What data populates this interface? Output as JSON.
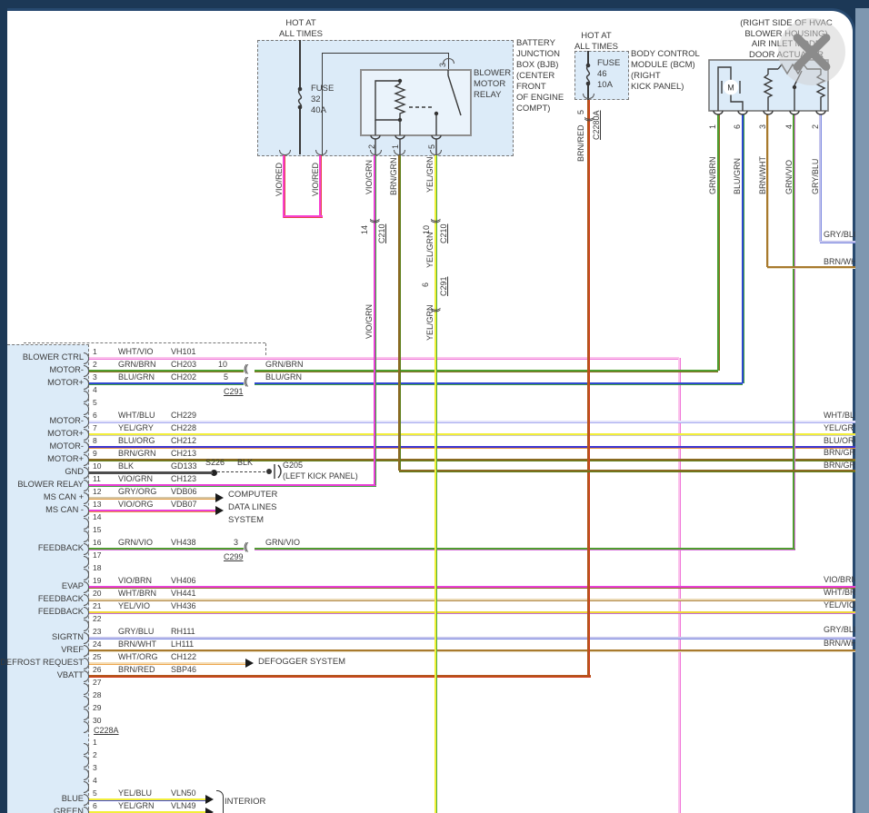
{
  "palette": {
    "backdrop": "#1c3856",
    "side_band": "#7e97b0",
    "box_fill": "#dcebf8",
    "card": "#ffffff",
    "line": "#3a3a3a"
  },
  "symbols": {
    "inline_connector": "((",
    "pin_arc": ")"
  },
  "wire_colors": {
    "WHT/VIO": [
      "#fbc4ec",
      "#f075d8"
    ],
    "GRN/BRN": [
      "#4f9d2f",
      "#8a6a22"
    ],
    "BLU/GRN": [
      "#2f49d0",
      "#3f9e3f"
    ],
    "WHT/BLU": [
      "#e2e2fa",
      "#a8acf0"
    ],
    "YEL/GRY": [
      "#f2ee3a",
      "#c9c9c9"
    ],
    "BLU/ORG": [
      "#3c35d2",
      "#e8933c"
    ],
    "BRN/GRN": [
      "#8a6a22",
      "#5d7d18"
    ],
    "BLK": [
      "#4d4d4d",
      "#4d4d4d"
    ],
    "VIO/GRN": [
      "#ea3fd7",
      "#3f9e3f"
    ],
    "GRY/ORG": [
      "#d4c7a9",
      "#e09a40"
    ],
    "VIO/ORG": [
      "#ea3fd7",
      "#e8933c"
    ],
    "GRN/VIO": [
      "#4f9d2f",
      "#da70dd"
    ],
    "VIO/BRN": [
      "#ea3fd7",
      "#8a6a22"
    ],
    "WHT/BRN": [
      "#ead9b5",
      "#b08848"
    ],
    "YEL/VIO": [
      "#eed63c",
      "#c06fd8"
    ],
    "GRY/BLU": [
      "#c5c5ec",
      "#7f8ce2"
    ],
    "BRN/WHT": [
      "#a87a2e",
      "#e8dcc2"
    ],
    "WHT/ORG": [
      "#f4dcb4",
      "#eda64e"
    ],
    "BRN/RED": [
      "#b5551c",
      "#d03a1c"
    ],
    "YEL/BLU": [
      "#f2ee3a",
      "#4049d8"
    ],
    "YEL/GRN": [
      "#f2ee3a",
      "#4aae3a"
    ],
    "VIO/RED": [
      "#f83fd0",
      "#e34848"
    ]
  },
  "tl": {
    "hot1": "HOT AT",
    "hot2": "ALL TIMES",
    "fuse": "FUSE",
    "fuse_no": "32",
    "fuse_amp": "40A",
    "bjb": [
      "BATTERY",
      "JUNCTION",
      "BOX (BJB)",
      "(CENTER",
      "FRONT",
      "OF ENGINE",
      "COMPT)"
    ],
    "relay": [
      "BLOWER",
      "MOTOR",
      "RELAY"
    ],
    "pin_top": "3",
    "pins_bottom": [
      "2",
      "1",
      "5"
    ],
    "viored": "VIO/RED",
    "viogrn": "VIO/GRN",
    "brngrn": "BRN/GRN",
    "yelgrn": "YEL/GRN",
    "c210": "C210",
    "c291": "C291",
    "p14": "14",
    "p10": "10",
    "p6": "6"
  },
  "tm": {
    "hot1": "HOT AT",
    "hot2": "ALL TIMES",
    "fuse": "FUSE",
    "fuse_no": "46",
    "fuse_amp": "10A",
    "bcm": [
      "BODY CONTROL",
      "MODULE (BCM)",
      "(RIGHT",
      "KICK PANEL)"
    ],
    "p5": "5",
    "conn": "C2280A",
    "wire": "BRN/RED"
  },
  "tr": {
    "title": [
      "(RIGHT SIDE OF HVAC",
      "BLOWER HOUSING)",
      "AIR INLET MODE",
      "DOOR ACTUATOR"
    ],
    "motor": "M",
    "pins": [
      "1",
      "6",
      "3",
      "4",
      "2"
    ],
    "wires": [
      "GRN/BRN",
      "BLU/GRN",
      "BRN/WHT",
      "GRN/VIO",
      "GRY/BLU"
    ]
  },
  "right_exits": [
    "GRY/BLU",
    "BRN/WHT",
    "WHT/BLU",
    "YEL/GRY",
    "BLU/ORG",
    "BRN/GRN",
    "BRN/GRN",
    "VIO/BRN",
    "WHT/BRN",
    "YEL/VIO",
    "GRY/BLU",
    "BRN/WHT"
  ],
  "module": {
    "pins": [
      {
        "n": "1",
        "label": "BLOWER CTRL",
        "color": "WHT/VIO",
        "circuit": "VH101"
      },
      {
        "n": "2",
        "label": "MOTOR-",
        "color": "GRN/BRN",
        "circuit": "CH203"
      },
      {
        "n": "3",
        "label": "MOTOR+",
        "color": "BLU/GRN",
        "circuit": "CH202"
      },
      {
        "n": "4"
      },
      {
        "n": "5"
      },
      {
        "n": "6",
        "label": "MOTOR-",
        "color": "WHT/BLU",
        "circuit": "CH229"
      },
      {
        "n": "7",
        "label": "MOTOR+",
        "color": "YEL/GRY",
        "circuit": "CH228"
      },
      {
        "n": "8",
        "label": "MOTOR-",
        "color": "BLU/ORG",
        "circuit": "CH212"
      },
      {
        "n": "9",
        "label": "MOTOR+",
        "color": "BRN/GRN",
        "circuit": "CH213"
      },
      {
        "n": "10",
        "label": "GND",
        "color": "BLK",
        "circuit": "GD133"
      },
      {
        "n": "11",
        "label": "BLOWER RELAY",
        "color": "VIO/GRN",
        "circuit": "CH123"
      },
      {
        "n": "12",
        "label": "MS CAN +",
        "color": "GRY/ORG",
        "circuit": "VDB06"
      },
      {
        "n": "13",
        "label": "MS CAN -",
        "color": "VIO/ORG",
        "circuit": "VDB07"
      },
      {
        "n": "14"
      },
      {
        "n": "15"
      },
      {
        "n": "16",
        "label": "FEEDBACK",
        "color": "GRN/VIO",
        "circuit": "VH438"
      },
      {
        "n": "17"
      },
      {
        "n": "18"
      },
      {
        "n": "19",
        "label": "EVAP",
        "color": "VIO/BRN",
        "circuit": "VH406"
      },
      {
        "n": "20",
        "label": "FEEDBACK",
        "color": "WHT/BRN",
        "circuit": "VH441"
      },
      {
        "n": "21",
        "label": "FEEDBACK",
        "color": "YEL/VIO",
        "circuit": "VH436"
      },
      {
        "n": "22"
      },
      {
        "n": "23",
        "label": "SIGRTN",
        "color": "GRY/BLU",
        "circuit": "RH111"
      },
      {
        "n": "24",
        "label": "VREF",
        "color": "BRN/WHT",
        "circuit": "LH111"
      },
      {
        "n": "25",
        "label": "DEFROST REQUEST",
        "color": "WHT/ORG",
        "circuit": "CH122"
      },
      {
        "n": "26",
        "label": "VBATT",
        "color": "BRN/RED",
        "circuit": "SBP46"
      },
      {
        "n": "27"
      },
      {
        "n": "28"
      },
      {
        "n": "29"
      },
      {
        "n": "30"
      }
    ],
    "conn_label": "C228A",
    "pins2": [
      {
        "n": "1"
      },
      {
        "n": "2"
      },
      {
        "n": "3"
      },
      {
        "n": "4"
      },
      {
        "n": "5",
        "label": "BLUE",
        "color": "YEL/BLU",
        "circuit": "VLN50"
      },
      {
        "n": "6",
        "label": "GREEN",
        "color": "YEL/GRN",
        "circuit": "VLN49"
      }
    ],
    "inline": {
      "c291": "C291",
      "c299": "C299",
      "p10": "10",
      "p5": "5",
      "p3": "3",
      "cont2": "GRN/BRN",
      "cont3": "BLU/GRN",
      "cont16": "GRN/VIO"
    },
    "gnd": {
      "splice": "S226",
      "wire": "BLK",
      "g": "G205",
      "loc": "(LEFT KICK PANEL)"
    },
    "notes": {
      "computer": [
        "COMPUTER",
        "DATA LINES",
        "SYSTEM"
      ],
      "defogger": "DEFOGGER SYSTEM",
      "interior": "INTERIOR"
    }
  }
}
